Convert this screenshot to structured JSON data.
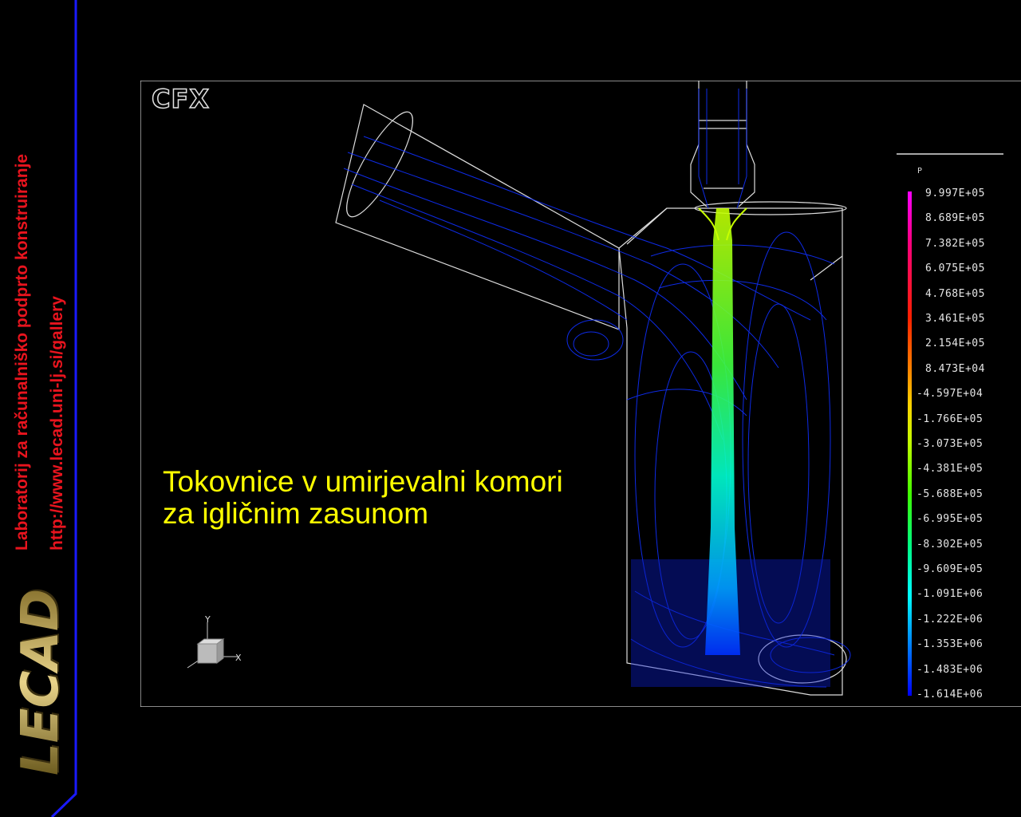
{
  "sidebar": {
    "lab_name": "Laboratorij za računalniško podprto konstruiranje",
    "url": "http://www.lecad.uni-lj.si/gallery",
    "logo_text": "LECAD",
    "text_color": "#e8141e",
    "border_color": "#1a1aff"
  },
  "viewport": {
    "software_logo": "CFX",
    "caption_line1": "Tokovnice v umirjevalni komori",
    "caption_line2": "za igličnim zasunom",
    "caption_color": "#ffff00",
    "axis_x_label": "X",
    "axis_y_label": "Y"
  },
  "legend": {
    "variable": "P",
    "ticks": [
      "9.997E+05",
      "8.689E+05",
      "7.382E+05",
      "6.075E+05",
      "4.768E+05",
      "3.461E+05",
      "2.154E+05",
      "8.473E+04",
      "-4.597E+04",
      "-1.766E+05",
      "-3.073E+05",
      "-4.381E+05",
      "-5.688E+05",
      "-6.995E+05",
      "-8.302E+05",
      "-9.609E+05",
      "-1.091E+06",
      "-1.222E+06",
      "-1.353E+06",
      "-1.483E+06",
      "-1.614E+06"
    ],
    "colormap": [
      "#ff00ff",
      "#ff0060",
      "#ff2000",
      "#ff8000",
      "#ffd000",
      "#c0ff00",
      "#40ff00",
      "#00ff80",
      "#00ffff",
      "#0080ff",
      "#0000ff"
    ]
  }
}
